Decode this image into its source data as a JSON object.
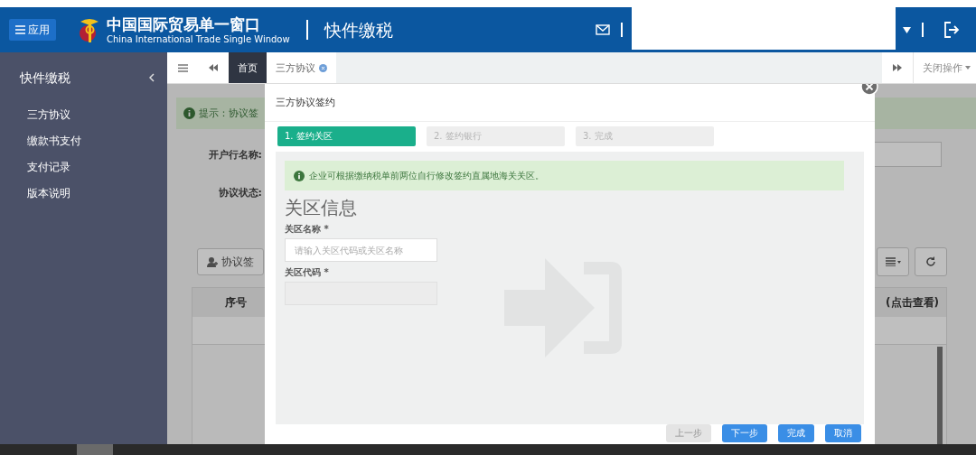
{
  "header": {
    "app_button": "应用",
    "logo_title": "中国国际贸易单一窗口",
    "logo_subtitle": "China International Trade Single Window",
    "module": "快件缴税"
  },
  "sidebar": {
    "title": "快件缴税",
    "items": [
      {
        "label": "三方协议"
      },
      {
        "label": "缴款书支付"
      },
      {
        "label": "支付记录"
      },
      {
        "label": "版本说明"
      }
    ]
  },
  "tabs": [
    {
      "label": "首页",
      "selected": true,
      "closable": false
    },
    {
      "label": "三方协议",
      "selected": false,
      "closable": true
    }
  ],
  "tab_actions": {
    "close_menu": "关闭操作"
  },
  "page": {
    "tip": "提示：协议签",
    "fields": [
      {
        "label": "开户行名称:"
      },
      {
        "label": "协议状态:"
      }
    ],
    "sign_button": "协议签",
    "table": {
      "columns": [
        "序号",
        "(点击查看)"
      ]
    }
  },
  "dialog": {
    "title": "三方协议签约",
    "steps": [
      {
        "label": "1. 签约关区",
        "selected": true
      },
      {
        "label": "2. 签约银行",
        "selected": false
      },
      {
        "label": "3. 完成",
        "selected": false
      }
    ],
    "notice": "企业可根据缴纳税单前两位自行修改签约直属地海关关区。",
    "section_title": "关区信息",
    "fields": [
      {
        "label": "关区名称 *",
        "placeholder": "请输入关区代码或关区名称",
        "disabled": false
      },
      {
        "label": "关区代码 *",
        "disabled": true
      }
    ],
    "buttons": [
      {
        "label": "上一步",
        "disabled": true
      },
      {
        "label": "下一步",
        "disabled": false
      },
      {
        "label": "完成",
        "disabled": false
      },
      {
        "label": "取消",
        "disabled": false
      }
    ]
  }
}
